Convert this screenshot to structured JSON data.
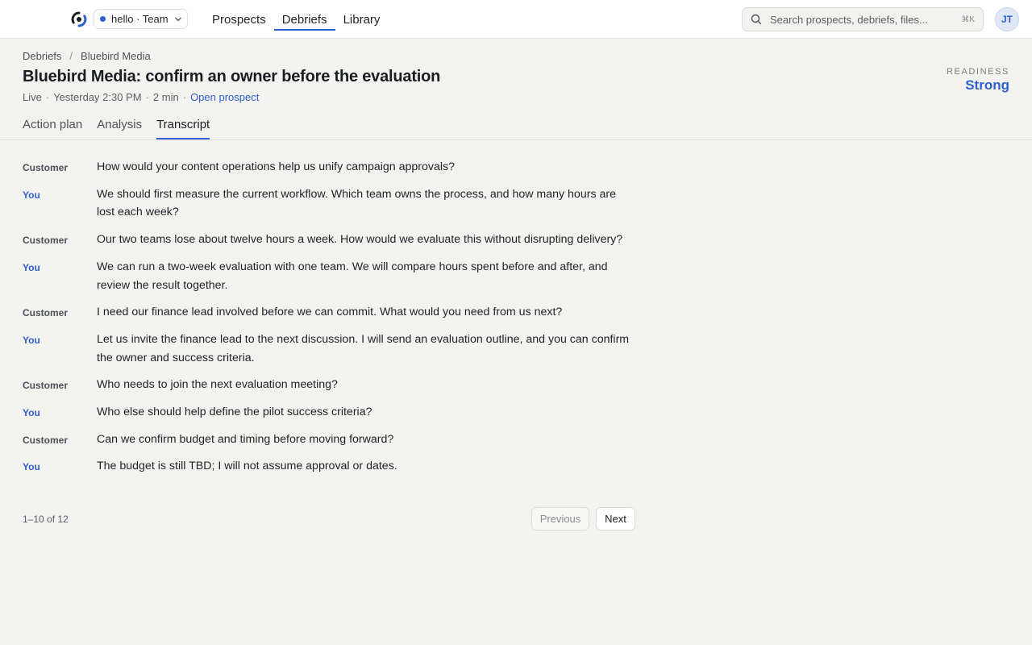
{
  "topbar": {
    "team_label": "hello · Team",
    "nav": [
      "Prospects",
      "Debriefs",
      "Library"
    ],
    "active_nav": "Debriefs",
    "search_placeholder": "Search prospects, debriefs, files...",
    "search_shortcut": "⌘K",
    "avatar_initials": "JT",
    "accent_color": "#2f5fd0"
  },
  "header": {
    "breadcrumb": [
      "Debriefs",
      "Bluebird Media"
    ],
    "breadcrumb_sep": "/",
    "title": "Bluebird Media: confirm an owner before the evaluation",
    "meta": {
      "status": "Live",
      "time": "Yesterday 2:30 PM",
      "duration": "2 min",
      "link": "Open prospect"
    },
    "readiness_label": "READINESS",
    "readiness_value": "Strong"
  },
  "tabs": [
    "Action plan",
    "Analysis",
    "Transcript"
  ],
  "active_tab": "Transcript",
  "transcript": [
    {
      "speaker": "Customer",
      "text": "How would your content operations help us unify campaign approvals?"
    },
    {
      "speaker": "You",
      "text": "We should first measure the current workflow. Which team owns the process, and how many hours are lost each week?"
    },
    {
      "speaker": "Customer",
      "text": "Our two teams lose about twelve hours a week. How would we evaluate this without disrupting delivery?"
    },
    {
      "speaker": "You",
      "text": "We can run a two-week evaluation with one team. We will compare hours spent before and after, and review the result together."
    },
    {
      "speaker": "Customer",
      "text": "I need our finance lead involved before we can commit. What would you need from us next?"
    },
    {
      "speaker": "You",
      "text": "Let us invite the finance lead to the next discussion. I will send an evaluation outline, and you can confirm the owner and success criteria."
    },
    {
      "speaker": "Customer",
      "text": "Who needs to join the next evaluation meeting?"
    },
    {
      "speaker": "You",
      "text": "Who else should help define the pilot success criteria?"
    },
    {
      "speaker": "Customer",
      "text": "Can we confirm budget and timing before moving forward?"
    },
    {
      "speaker": "You",
      "text": "The budget is still TBD; I will not assume approval or dates."
    }
  ],
  "pagination": {
    "info": "1–10 of 12",
    "previous": "Previous",
    "next": "Next"
  }
}
